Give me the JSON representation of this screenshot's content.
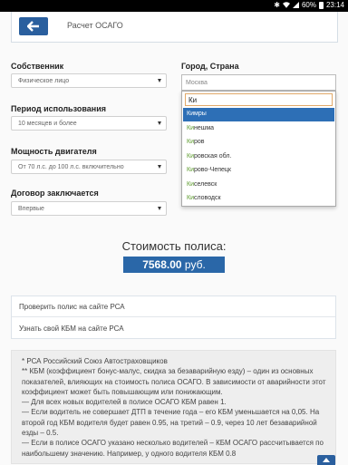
{
  "status_bar": {
    "battery": "60%",
    "time": "23:14"
  },
  "header": {
    "title": "Расчет ОСАГО",
    "back_icon": "arrow-left-icon"
  },
  "form": {
    "owner": {
      "label": "Собственник",
      "value": "Физическое лицо"
    },
    "period": {
      "label": "Период использования",
      "value": "10 месяцев и более"
    },
    "power": {
      "label": "Мощность двигателя",
      "value": "От 70 л.с. до 100 л.с. включительно"
    },
    "contract": {
      "label": "Договор заключается",
      "value": "Впервые"
    },
    "city": {
      "label": "Город, Страна",
      "value": "Москва",
      "search_text": "Ки",
      "options": [
        {
          "match": "Ки",
          "rest": "мры",
          "highlighted": true
        },
        {
          "match": "Ки",
          "rest": "нешма",
          "highlighted": false
        },
        {
          "match": "Ки",
          "rest": "ров",
          "highlighted": false
        },
        {
          "match": "Ки",
          "rest": "ровская обл.",
          "highlighted": false
        },
        {
          "match": "Ки",
          "rest": "рово-Чепецк",
          "highlighted": false
        },
        {
          "match": "Ки",
          "rest": "селевск",
          "highlighted": false
        },
        {
          "match": "Ки",
          "rest": "словодск",
          "highlighted": false
        }
      ]
    }
  },
  "price": {
    "title": "Стоимость полиса:",
    "amount": "7568.00",
    "currency": "руб."
  },
  "links": [
    "Проверить полис на сайте РСА",
    "Узнать свой КБМ на сайте РСА"
  ],
  "notes": [
    "* РСА Российский Союз Автостраховщиков",
    "** КБМ (коэффициент бонус-малус, скидка за безаварийную езду) – один из основных показателей, влияющих на стоимость полиса ОСАГО. В зависимости от аварийности этот коэффициент может быть повышающим или понижающим.",
    "— Для всех новых водителей в полисе ОСАГО КБМ равен 1.",
    "— Если водитель не совершает ДТП в течение года – его КБМ уменьшается на 0,05. На второй год КБМ водителя будет равен 0.95, на третий – 0.9, через 10 лет безаварийной езды – 0.5.",
    "— Если в полисе ОСАГО указано несколько водителей – КБМ ОСАГО рассчитывается по наибольшему значению. Например, у одного водителя КБМ 0.8"
  ],
  "colors": {
    "primary": "#2a5f9e",
    "highlight": "#2d6fb6",
    "match": "#5b9a2a"
  }
}
